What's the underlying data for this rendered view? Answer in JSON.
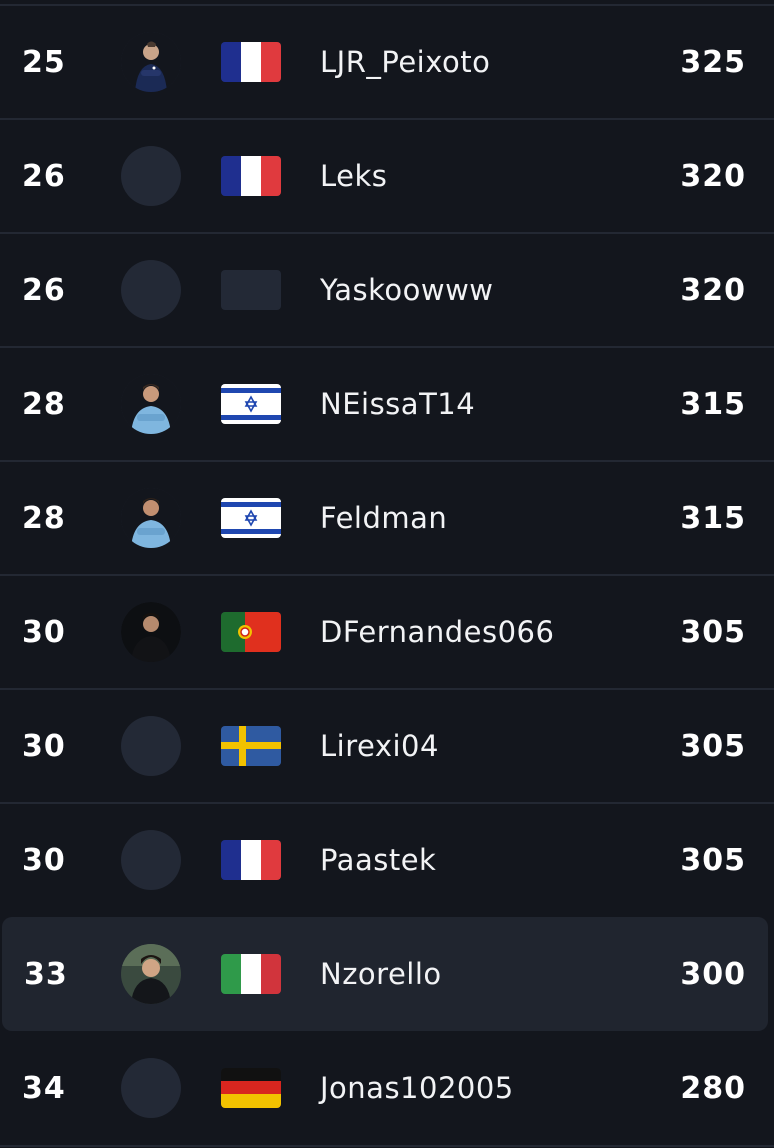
{
  "leaderboard": {
    "rows": [
      {
        "rank": "25",
        "name": "LJR_Peixoto",
        "points": "325",
        "flag": "france-flag",
        "avatar": "player-photo"
      },
      {
        "rank": "26",
        "name": "Leks",
        "points": "320",
        "flag": "france-flag",
        "avatar": "placeholder"
      },
      {
        "rank": "26",
        "name": "Yaskoowww",
        "points": "320",
        "flag": "blank-flag",
        "avatar": "placeholder"
      },
      {
        "rank": "28",
        "name": "NEissaT14",
        "points": "315",
        "flag": "israel-flag",
        "avatar": "player-photo"
      },
      {
        "rank": "28",
        "name": "Feldman",
        "points": "315",
        "flag": "israel-flag",
        "avatar": "player-photo"
      },
      {
        "rank": "30",
        "name": "DFernandes066",
        "points": "305",
        "flag": "portugal-flag",
        "avatar": "player-photo"
      },
      {
        "rank": "30",
        "name": "Lirexi04",
        "points": "305",
        "flag": "sweden-flag",
        "avatar": "placeholder"
      },
      {
        "rank": "30",
        "name": "Paastek",
        "points": "305",
        "flag": "france-flag",
        "avatar": "placeholder"
      },
      {
        "rank": "33",
        "name": "Nzorello",
        "points": "300",
        "flag": "italy-flag",
        "avatar": "player-photo",
        "highlighted": true
      },
      {
        "rank": "34",
        "name": "Jonas102005",
        "points": "280",
        "flag": "germany-flag",
        "avatar": "placeholder"
      }
    ]
  },
  "colors": {
    "background": "#13161d",
    "row_divider": "#232833",
    "highlight_row": "#20252f",
    "placeholder": "#232936",
    "text": "#ffffff"
  }
}
